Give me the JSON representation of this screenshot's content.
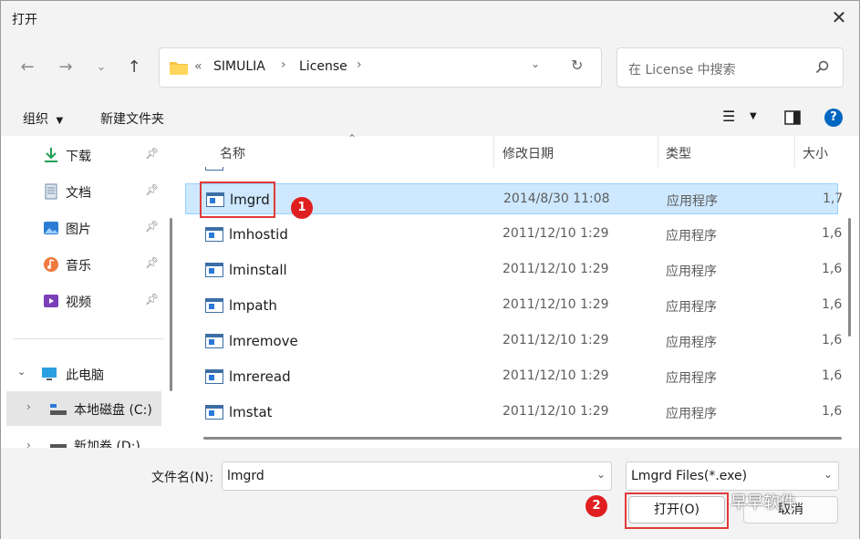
{
  "window": {
    "title": "打开",
    "close_glyph": "✕"
  },
  "nav": {
    "back_icon": "arrow-left-icon",
    "forward_icon": "arrow-right-icon",
    "recent_icon": "chevron-down-icon",
    "up_icon": "arrow-up-icon",
    "breadcrumb_overflow": "«",
    "breadcrumbs": [
      "SIMULIA",
      "License"
    ],
    "search_placeholder": "在 License 中搜索"
  },
  "toolbar": {
    "organize": "组织",
    "new_folder": "新建文件夹"
  },
  "sidebar": {
    "items": [
      {
        "label": "下载",
        "icon": "download-icon",
        "pinned": true
      },
      {
        "label": "文档",
        "icon": "document-icon",
        "pinned": true
      },
      {
        "label": "图片",
        "icon": "picture-icon",
        "pinned": true
      },
      {
        "label": "音乐",
        "icon": "music-icon",
        "pinned": true
      },
      {
        "label": "视频",
        "icon": "video-icon",
        "pinned": true
      }
    ],
    "this_pc": "此电脑",
    "drives": [
      {
        "label": "本地磁盘 (C:)"
      },
      {
        "label": "新加卷 (D:)"
      }
    ]
  },
  "list": {
    "headers": {
      "name": "名称",
      "date": "修改日期",
      "type": "类型",
      "size": "大小"
    },
    "rows": [
      {
        "name": "lmgrd",
        "date": "2014/8/30 11:08",
        "type": "应用程序",
        "size": "1,7",
        "selected": true
      },
      {
        "name": "lmhostid",
        "date": "2011/12/10 1:29",
        "type": "应用程序",
        "size": "1,6"
      },
      {
        "name": "lminstall",
        "date": "2011/12/10 1:29",
        "type": "应用程序",
        "size": "1,6"
      },
      {
        "name": "lmpath",
        "date": "2011/12/10 1:29",
        "type": "应用程序",
        "size": "1,6"
      },
      {
        "name": "lmremove",
        "date": "2011/12/10 1:29",
        "type": "应用程序",
        "size": "1,6"
      },
      {
        "name": "lmreread",
        "date": "2011/12/10 1:29",
        "type": "应用程序",
        "size": "1,6"
      },
      {
        "name": "lmstat",
        "date": "2011/12/10 1:29",
        "type": "应用程序",
        "size": "1,6"
      }
    ]
  },
  "footer": {
    "filename_label": "文件名(N):",
    "filename_value": "lmgrd",
    "filter_value": "Lmgrd Files(*.exe)",
    "open_button": "打开(O)",
    "cancel_button": "取消"
  },
  "annotations": {
    "badge1": "1",
    "badge2": "2"
  },
  "watermark": "早早软件",
  "colors": {
    "accent": "#0067c0",
    "selection": "#cde8ff",
    "highlight": "#e03a3a"
  }
}
